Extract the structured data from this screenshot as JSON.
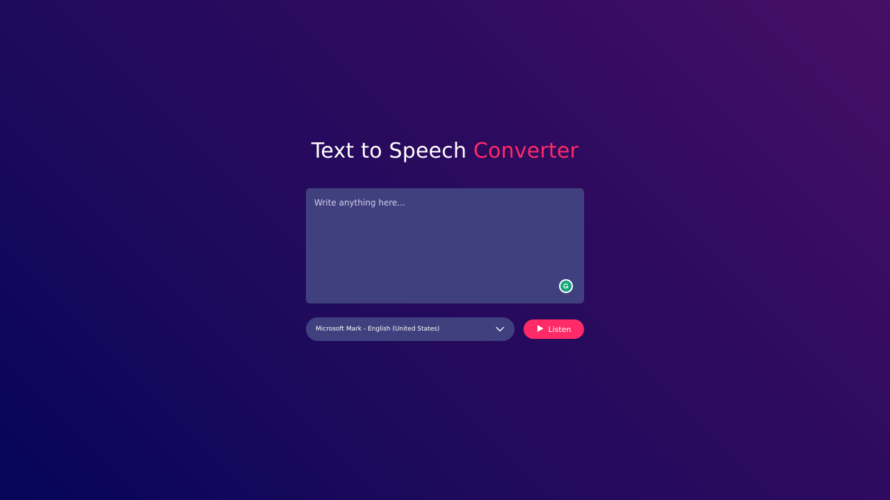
{
  "header": {
    "title_main": "Text to Speech ",
    "title_accent": "Converter"
  },
  "editor": {
    "placeholder": "Write anything here...",
    "value": "",
    "assistant_icon": "grammarly-icon"
  },
  "controls": {
    "voice_selected": "Microsoft Mark - English (United States)",
    "voice_icon": "chevron-down-icon",
    "listen_label": "Listen",
    "listen_icon": "play-icon"
  },
  "colors": {
    "accent": "#ff2a68",
    "panel": "#41407f",
    "background_start": "#05055a",
    "background_end": "#470f66"
  }
}
